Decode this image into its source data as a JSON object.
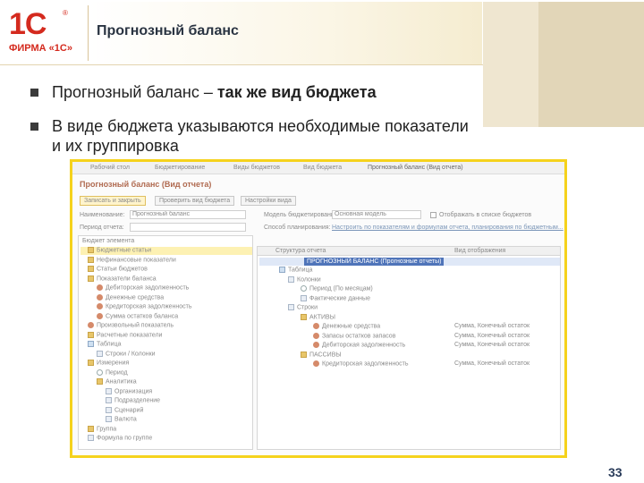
{
  "logo": {
    "mark": "1С",
    "registered": "®",
    "firm": "ФИРМА «1С»"
  },
  "slide_title": "Прогнозный баланс",
  "bullets": [
    {
      "prefix": "Прогнозный баланс – ",
      "bold": "так же вид бюджета"
    },
    {
      "text": "В виде бюджета указываются необходимые показатели и их группировка"
    }
  ],
  "page_number": "33",
  "app": {
    "tabs": [
      "Рабочий стол",
      "Бюджетирование",
      "Виды бюджетов",
      "Вид бюджета",
      "Прогнозный баланс (Вид отчета)"
    ],
    "title": "Прогнозный баланс (Вид отчета)",
    "buttons": {
      "save_close": "Записать и закрыть",
      "check": "Проверить вид бюджета",
      "settings": "Настройки вида"
    },
    "fields": {
      "name_label": "Наименование:",
      "name_value": "Прогнозный баланс",
      "model_label": "Модель бюджетирования:",
      "model_value": "Основная модель",
      "checkbox_label": "Отображать в списке бюджетов",
      "period_label": "Период отчета:",
      "edit_mode_label": "Способ планирования:",
      "description_link": "Настроить по показателям и формулам отчета, планирования по бюджетным..."
    },
    "left_panel": {
      "header": "Бюджет элемента",
      "items": [
        {
          "label": "Бюджетные статьи",
          "icon": "folder-icon"
        },
        {
          "label": "Нефинансовые показатели",
          "icon": "folder-icon"
        },
        {
          "label": "Статьи бюджетов",
          "icon": "folder-icon"
        },
        {
          "label": "Показатели баланса",
          "icon": "folder-icon"
        },
        {
          "label": "Дебиторская задолженность",
          "icon": "item-icon"
        },
        {
          "label": "Денежные средства",
          "icon": "item-icon"
        },
        {
          "label": "Кредиторская задолженность",
          "icon": "item-icon"
        },
        {
          "label": "Сумма остатков баланса",
          "icon": "item-icon"
        },
        {
          "label": "Произвольный показатель",
          "icon": "item-icon"
        },
        {
          "label": "Расчетные показатели",
          "icon": "folder-icon"
        },
        {
          "label": "Таблица",
          "icon": "table-icon"
        },
        {
          "label": "Строки / Колонки",
          "icon": "list-icon"
        },
        {
          "label": "Измерения",
          "icon": "folder-icon"
        },
        {
          "label": "Период",
          "icon": "clock-icon"
        },
        {
          "label": "Аналитика",
          "icon": "folder-icon"
        },
        {
          "label": "Организация",
          "icon": "list-icon"
        },
        {
          "label": "Подразделение",
          "icon": "list-icon"
        },
        {
          "label": "Сценарий",
          "icon": "list-icon"
        },
        {
          "label": "Валюта",
          "icon": "list-icon"
        },
        {
          "label": "Группа",
          "icon": "folder-icon"
        },
        {
          "label": "Формула по группе",
          "icon": "list-icon"
        }
      ]
    },
    "right_panel": {
      "col_structure": "Структура отчета",
      "col_output": "Вид отображения",
      "selected": "ПРОГНОЗНЫЙ БАЛАНС (Прогнозные отчеты)",
      "rows": [
        {
          "label": "Таблица",
          "icon": "table-icon",
          "value": ""
        },
        {
          "label": "Колонки",
          "icon": "list-icon",
          "value": ""
        },
        {
          "label": "Период (По месяцам)",
          "icon": "clock-icon",
          "value": ""
        },
        {
          "label": "Фактические данные",
          "icon": "list-icon",
          "value": ""
        },
        {
          "label": "Строки",
          "icon": "list-icon",
          "value": ""
        },
        {
          "label": "АКТИВЫ",
          "icon": "folder-icon",
          "value": ""
        },
        {
          "label": "Денежные средства",
          "icon": "item-icon",
          "value": "Сумма, Конечный остаток"
        },
        {
          "label": "Запасы остатков запасов",
          "icon": "item-icon",
          "value": "Сумма, Конечный остаток"
        },
        {
          "label": "Дебиторская задолженность",
          "icon": "item-icon",
          "value": "Сумма, Конечный остаток"
        },
        {
          "label": "ПАССИВЫ",
          "icon": "folder-icon",
          "value": ""
        },
        {
          "label": "Кредиторская задолженность",
          "icon": "item-icon",
          "value": "Сумма, Конечный остаток"
        }
      ]
    }
  }
}
